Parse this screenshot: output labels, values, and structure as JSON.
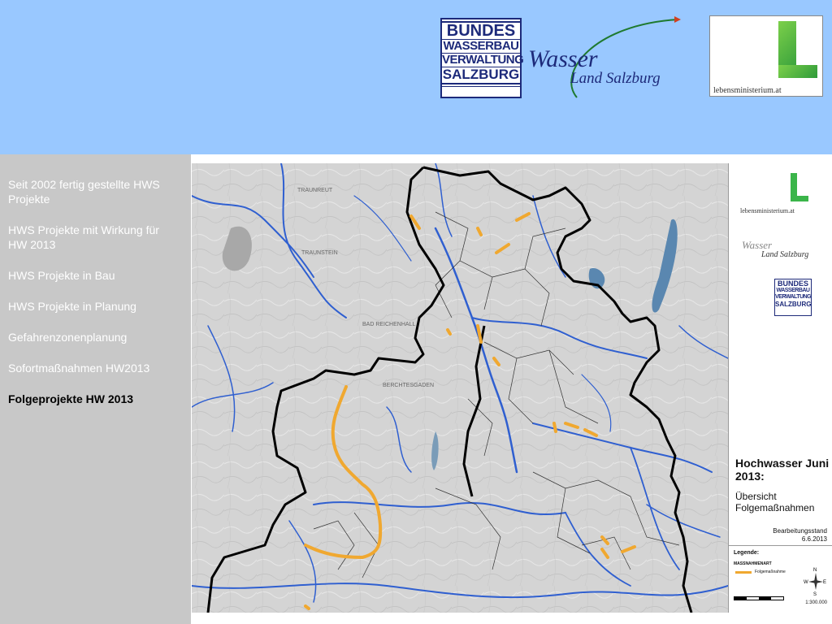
{
  "header": {
    "bundes_lines": [
      "BUNDES",
      "WASSERBAU",
      "VERWALTUNG",
      "SALZBURG"
    ],
    "wasser": "Wasser",
    "land_salzburg": "Land Salzburg",
    "lebensministerium": "lebensministerium.at"
  },
  "sidebar": {
    "items": [
      {
        "label": "Seit 2002 fertig gestellte HWS Projekte",
        "active": false
      },
      {
        "label": "HWS Projekte mit Wirkung für HW 2013",
        "active": false
      },
      {
        "label": "HWS Projekte in Bau",
        "active": false
      },
      {
        "label": "HWS Projekte in Planung",
        "active": false
      },
      {
        "label": "Gefahrenzonenplanung",
        "active": false
      },
      {
        "label": "Sofortmaßnahmen HW2013",
        "active": false
      },
      {
        "label": "Folgeprojekte HW 2013",
        "active": true
      }
    ]
  },
  "map": {
    "labels": [
      "TRAUNREUT",
      "TRAUNSTEIN",
      "BAD REICHENHALL",
      "BERCHTESGADEN"
    ],
    "legend": {
      "lebensministerium": "lebensministerium.at",
      "wasser": "Wasser",
      "land_salzburg": "Land Salzburg",
      "bundes_lines": [
        "BUNDES",
        "WASSERBAU",
        "VERWALTUNG",
        "SALZBURG"
      ],
      "title": "Hochwasser Juni 2013:",
      "subtitle": "Übersicht Folgemaßnahmen",
      "stand_label": "Bearbeitungsstand",
      "stand_date": "6.6.2013",
      "legende": "Legende:",
      "massnahmenart": "MASSNAHMENART",
      "item": "Folgemaßnahme",
      "scale": "1:300.000",
      "north": "N",
      "south": "S",
      "east": "E",
      "west": "W"
    }
  },
  "colors": {
    "header_bg": "#99c8ff",
    "sidebar_bg": "#c8c8c8",
    "river": "#2f5fd0",
    "measure": "#f0a830",
    "boundary": "#000000",
    "brand_blue": "#1d2a7a",
    "brand_green": "#3bb54a"
  }
}
